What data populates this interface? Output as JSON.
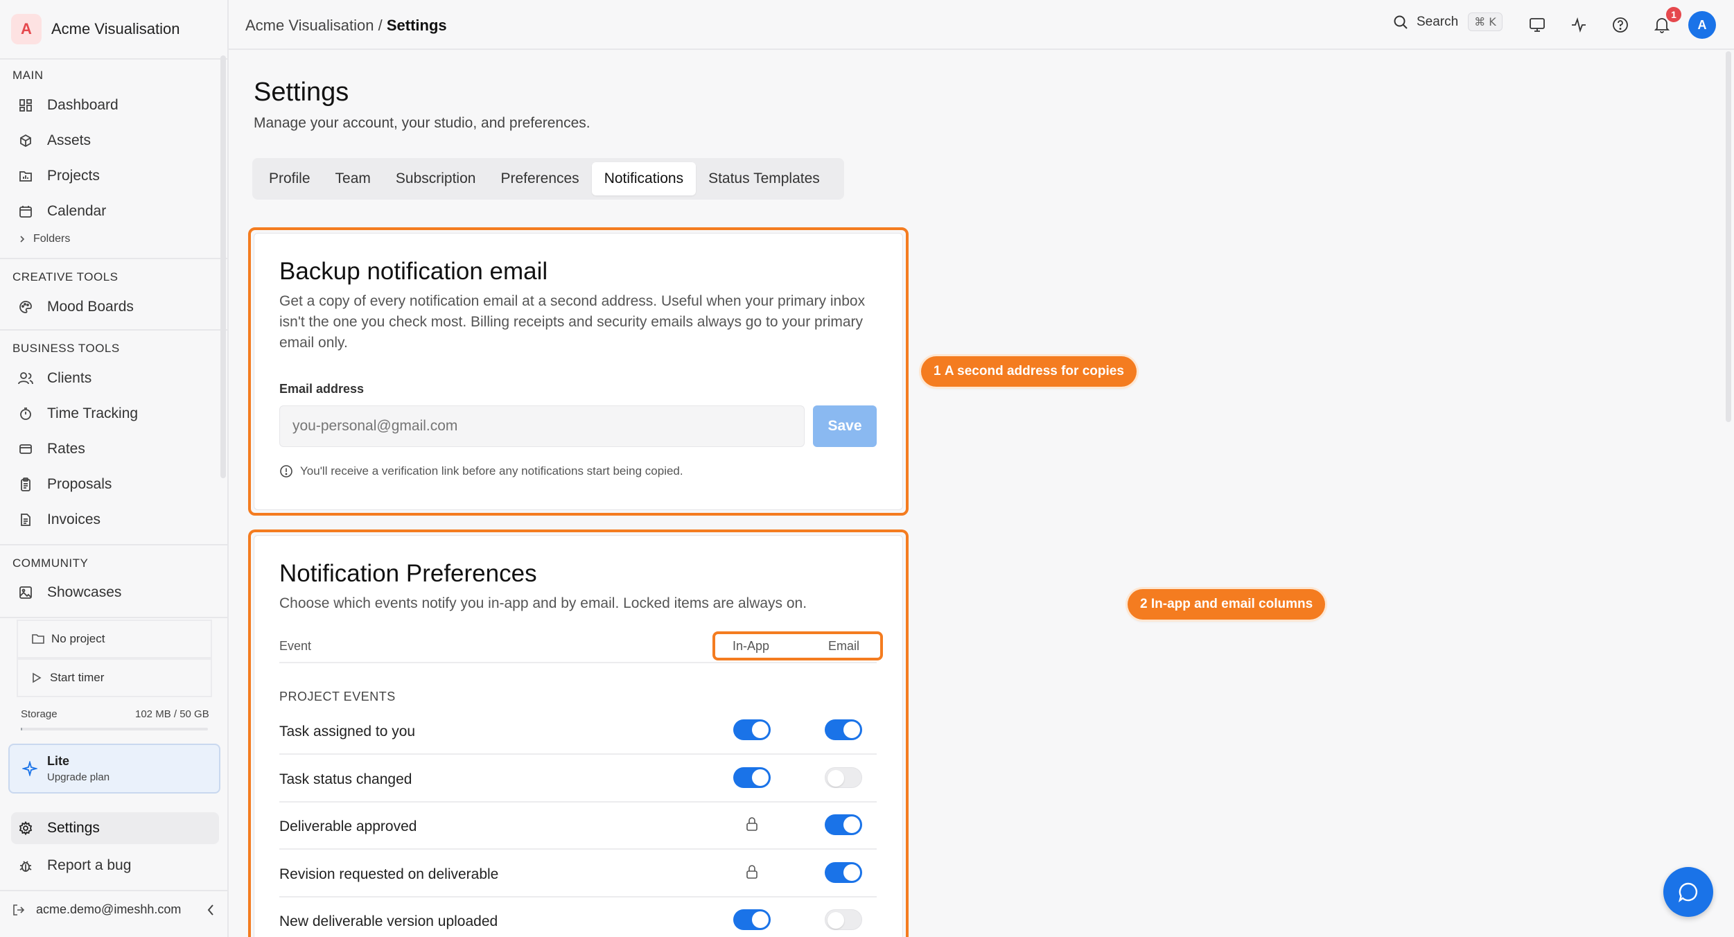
{
  "app": {
    "logo_letter": "A",
    "name": "Acme Visualisation",
    "accent_color": "#1a73e8",
    "highlight_color": "#f47c20"
  },
  "sidebar": {
    "sections": {
      "main": "MAIN",
      "creative": "CREATIVE TOOLS",
      "business": "BUSINESS TOOLS",
      "community": "COMMUNITY"
    },
    "main_items": [
      {
        "label": "Dashboard",
        "icon": "dashboard-icon"
      },
      {
        "label": "Assets",
        "icon": "cube-icon"
      },
      {
        "label": "Projects",
        "icon": "folder-chart-icon"
      },
      {
        "label": "Calendar",
        "icon": "calendar-icon"
      }
    ],
    "folders_label": "Folders",
    "creative_items": [
      {
        "label": "Mood Boards",
        "icon": "palette-icon"
      }
    ],
    "business_items": [
      {
        "label": "Clients",
        "icon": "users-icon"
      },
      {
        "label": "Time Tracking",
        "icon": "timer-icon"
      },
      {
        "label": "Rates",
        "icon": "card-icon"
      },
      {
        "label": "Proposals",
        "icon": "clipboard-icon"
      },
      {
        "label": "Invoices",
        "icon": "document-icon"
      }
    ],
    "community_items": [
      {
        "label": "Showcases",
        "icon": "image-icon"
      }
    ],
    "timer": {
      "project_label": "No project",
      "start_label": "Start timer"
    },
    "storage": {
      "label": "Storage",
      "value": "102 MB / 50 GB",
      "fraction": 0.002
    },
    "plan": {
      "title": "Lite",
      "subtitle": "Upgrade plan"
    },
    "settings_label": "Settings",
    "report_label": "Report a bug",
    "user_email": "acme.demo@imeshh.com"
  },
  "topbar": {
    "breadcrumb_root": "Acme Visualisation",
    "breadcrumb_sep": "/",
    "breadcrumb_current": "Settings",
    "search_label": "Search",
    "search_shortcut": "⌘ K",
    "notification_count": "1",
    "avatar_letter": "A"
  },
  "page": {
    "title": "Settings",
    "subtitle": "Manage your account, your studio, and preferences.",
    "tabs": [
      "Profile",
      "Team",
      "Subscription",
      "Preferences",
      "Notifications",
      "Status Templates"
    ],
    "active_tab": "Notifications"
  },
  "backup": {
    "title": "Backup notification email",
    "description": "Get a copy of every notification email at a second address. Useful when your primary inbox isn't the one you check most. Billing receipts and security emails always go to your primary email only.",
    "field_label": "Email address",
    "input_placeholder": "you-personal@gmail.com",
    "input_value": "",
    "save_label": "Save",
    "hint": "You'll receive a verification link before any notifications start being copied."
  },
  "prefs": {
    "title": "Notification Preferences",
    "description": "Choose which events notify you in-app and by email. Locked items are always on.",
    "col_event": "Event",
    "col_inapp": "In-App",
    "col_email": "Email",
    "group_label": "PROJECT EVENTS",
    "rows": [
      {
        "label": "Task assigned to you",
        "inapp": "on",
        "email": "on"
      },
      {
        "label": "Task status changed",
        "inapp": "on",
        "email": "off"
      },
      {
        "label": "Deliverable approved",
        "inapp": "locked",
        "email": "on"
      },
      {
        "label": "Revision requested on deliverable",
        "inapp": "locked",
        "email": "on"
      },
      {
        "label": "New deliverable version uploaded",
        "inapp": "on",
        "email": "off"
      }
    ]
  },
  "callouts": [
    {
      "number": "1",
      "text": "A second address for copies"
    },
    {
      "number": "2",
      "text": "In-app and email columns"
    }
  ]
}
